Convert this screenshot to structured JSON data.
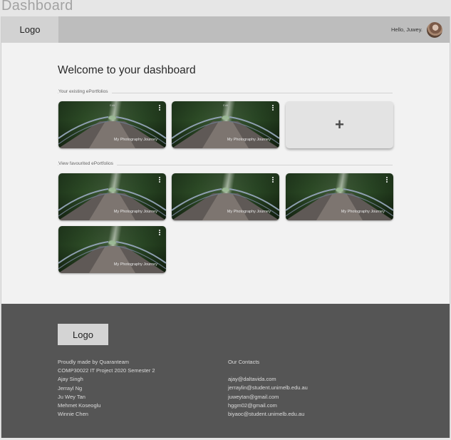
{
  "window": {
    "title": "Dashboard"
  },
  "navbar": {
    "logo": "Logo",
    "greeting": "Hello, Juwey."
  },
  "main": {
    "title": "Welcome to your dashboard",
    "existing_label": "Your existing ePortfolios",
    "favourited_label": "View favourited ePortfolios",
    "existing_cards": [
      {
        "title": "My Photography Journey"
      },
      {
        "title": "My Photography Journey"
      }
    ],
    "add_card_symbol": "+",
    "favourited_cards": [
      {
        "title": "My Photography Journey"
      },
      {
        "title": "My Photography Journey"
      },
      {
        "title": "My Photography Journey"
      },
      {
        "title": "My Photography Journey"
      }
    ]
  },
  "footer": {
    "logo": "Logo",
    "made_by": "Proudly made by Quaranteam",
    "project": "COMP30022 IT Project 2020 Semester 2",
    "members": [
      "Ajay Singh",
      "Jerrayl Ng",
      "Ju Wey Tan",
      "Mehmet Koseoglu",
      "Winnie Chen"
    ],
    "contacts_title": "Our Contacts",
    "contacts": [
      "ajay@daltavida.com",
      "jerraylin@student.unimelb.edu.au",
      "juweytan@gmail.com",
      "hggm02@gmail.com",
      "biyaoc@student.unimelb.edu.au"
    ]
  }
}
